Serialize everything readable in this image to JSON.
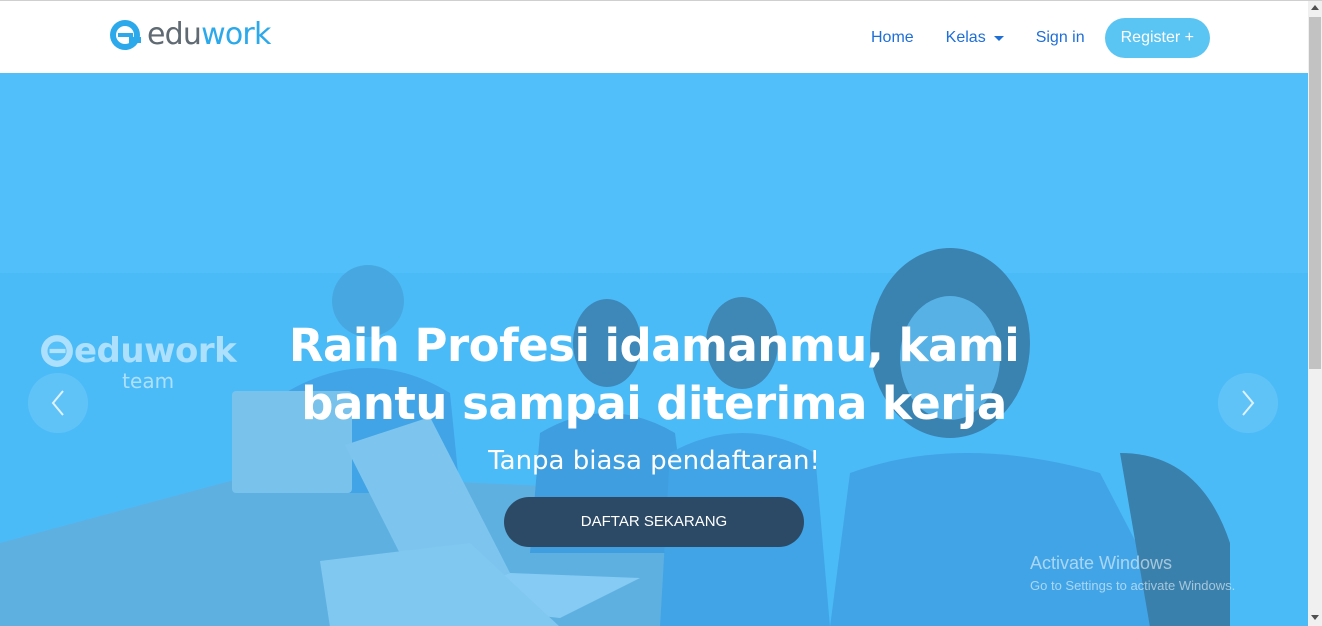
{
  "brand": {
    "part1": "edu",
    "part2": "work",
    "logo_icon": "eduwork-e-logo-icon",
    "accent_color": "#2ba9ea"
  },
  "nav": {
    "home": "Home",
    "kelas": "Kelas",
    "signin": "Sign in",
    "register": "Register +"
  },
  "hero": {
    "title_line1": "Raih Profesi idamanmu, kami",
    "title_line2": "bantu sampai diterima kerja",
    "subtitle": "Tanpa biasa pendaftaran!",
    "cta": "DAFTAR SEKARANG",
    "photo_watermark_word": "eduwork",
    "photo_watermark_team": "team",
    "prev_icon": "chevron-left-icon",
    "next_icon": "chevron-right-icon"
  },
  "os_watermark": {
    "line1": "Activate Windows",
    "line2": "Go to Settings to activate Windows."
  },
  "colors": {
    "hero_blue": "#4dbdf8",
    "cta_dark": "#2c4a66",
    "register_bg": "#5ac4f3",
    "nav_link": "#1e6ed8"
  }
}
